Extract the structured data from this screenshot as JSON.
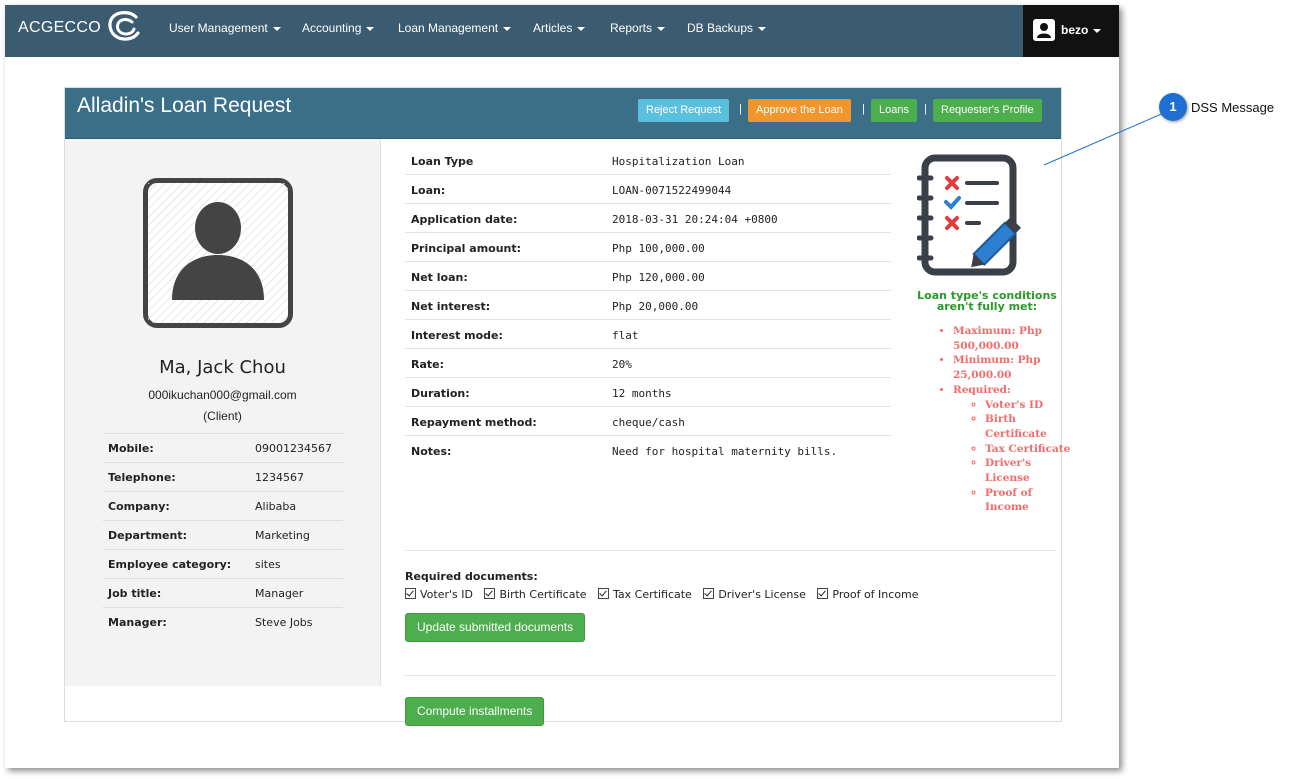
{
  "navbar": {
    "brand": "ACGECCO",
    "menu": [
      {
        "label": "User Management"
      },
      {
        "label": "Accounting"
      },
      {
        "label": "Loan Management"
      },
      {
        "label": "Articles"
      },
      {
        "label": "Reports"
      },
      {
        "label": "DB Backups"
      }
    ],
    "user": "bezo"
  },
  "panel": {
    "title": "Alladin's Loan Request",
    "actions": {
      "reject": "Reject Request",
      "approve": "Approve the Loan",
      "loans": "Loans",
      "profile": "Requester's Profile",
      "separator": "|"
    }
  },
  "profile": {
    "name": "Ma, Jack Chou",
    "email": "000ikuchan000@gmail.com",
    "role": "(Client)",
    "fields": [
      {
        "label": "Mobile:",
        "value": "09001234567"
      },
      {
        "label": "Telephone:",
        "value": "1234567"
      },
      {
        "label": "Company:",
        "value": "Alibaba"
      },
      {
        "label": "Department:",
        "value": "Marketing"
      },
      {
        "label": "Employee category:",
        "value": "sites"
      },
      {
        "label": "Job title:",
        "value": "Manager"
      },
      {
        "label": "Manager:",
        "value": "Steve Jobs"
      }
    ]
  },
  "loan": [
    {
      "label": "Loan Type",
      "value": "Hospitalization Loan"
    },
    {
      "label": "Loan:",
      "value": "LOAN-0071522499044"
    },
    {
      "label": "Application date:",
      "value": "2018-03-31 20:24:04 +0800"
    },
    {
      "label": "Principal amount:",
      "value": "Php 100,000.00"
    },
    {
      "label": "Net loan:",
      "value": "Php 120,000.00"
    },
    {
      "label": "Net interest:",
      "value": "Php 20,000.00"
    },
    {
      "label": "Interest mode:",
      "value": "flat"
    },
    {
      "label": "Rate:",
      "value": "20%"
    },
    {
      "label": "Duration:",
      "value": "12 months"
    },
    {
      "label": "Repayment method:",
      "value": "cheque/cash"
    },
    {
      "label": "Notes:",
      "value": "Need for hospital maternity bills."
    }
  ],
  "dss": {
    "title": "Loan type's conditions aren't fully met:",
    "maximum": "Maximum: Php 500,000.00",
    "minimum": "Minimum: Php 25,000.00",
    "required_label": "Required:",
    "required": [
      "Voter's ID",
      "Birth Certificate",
      "Tax Certificate",
      "Driver's License",
      "Proof of Income"
    ]
  },
  "documents": {
    "label": "Required documents:",
    "items": [
      "Voter's ID",
      "Birth Certificate",
      "Tax Certificate",
      "Driver's License",
      "Proof of Income"
    ],
    "update_button": "Update submitted documents",
    "compute_button": "Compute installments"
  },
  "callout": {
    "number": "1",
    "label": "DSS Message"
  },
  "colors": {
    "navbar": "#3b5b70",
    "panel_header": "#3b6f87",
    "reject_button": "#5bc0de",
    "approve_button": "#f0962a",
    "green_button": "#4cae4c",
    "dss_title": "#2a9a2a",
    "dss_text": "#f26b6b",
    "callout_badge": "#1e6fd1"
  }
}
